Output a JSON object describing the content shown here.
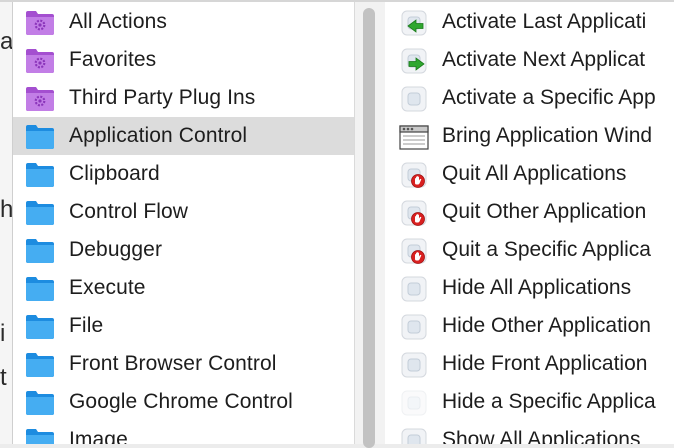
{
  "background_window": {
    "fragments": [
      "a",
      "h",
      "i",
      "t"
    ]
  },
  "categories": [
    {
      "label": "All Actions",
      "icon": "purple-gear-folder-icon"
    },
    {
      "label": "Favorites",
      "icon": "purple-gear-folder-icon"
    },
    {
      "label": "Third Party Plug Ins",
      "icon": "purple-gear-folder-icon"
    },
    {
      "label": "Application Control",
      "icon": "blue-folder-icon",
      "selected": true
    },
    {
      "label": "Clipboard",
      "icon": "blue-folder-icon"
    },
    {
      "label": "Control Flow",
      "icon": "blue-folder-icon"
    },
    {
      "label": "Debugger",
      "icon": "blue-folder-icon"
    },
    {
      "label": "Execute",
      "icon": "blue-folder-icon"
    },
    {
      "label": "File",
      "icon": "blue-folder-icon"
    },
    {
      "label": "Front Browser Control",
      "icon": "blue-folder-icon"
    },
    {
      "label": "Google Chrome Control",
      "icon": "blue-folder-icon"
    },
    {
      "label": "Image",
      "icon": "blue-folder-icon"
    }
  ],
  "actions": [
    {
      "label": "Activate Last Applicati",
      "icon": "app-with-green-left-arrow-icon"
    },
    {
      "label": "Activate Next Applicat",
      "icon": "app-with-green-right-arrow-icon"
    },
    {
      "label": "Activate a Specific App",
      "icon": "app-icon"
    },
    {
      "label": "Bring Application Wind",
      "icon": "window-icon"
    },
    {
      "label": "Quit All Applications",
      "icon": "app-with-red-stop-icon"
    },
    {
      "label": "Quit Other Application",
      "icon": "app-with-red-stop-icon"
    },
    {
      "label": "Quit a Specific Applica",
      "icon": "app-with-red-stop-icon"
    },
    {
      "label": "Hide All Applications",
      "icon": "app-icon"
    },
    {
      "label": "Hide Other Application",
      "icon": "app-icon"
    },
    {
      "label": "Hide Front Application",
      "icon": "app-icon"
    },
    {
      "label": "Hide a Specific Applica",
      "icon": "faded-app-icon"
    },
    {
      "label": "Show All Applications",
      "icon": "app-icon"
    }
  ],
  "colors": {
    "purple_folder": "#b05ad8",
    "blue_folder": "#3aa6f0",
    "selected_row": "#dcdcdc"
  }
}
